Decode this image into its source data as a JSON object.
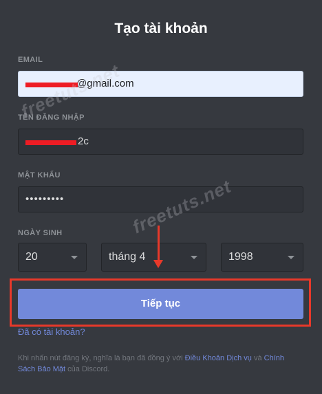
{
  "title": "Tạo tài khoản",
  "email": {
    "label": "EMAIL",
    "value": "@gmail.com"
  },
  "username": {
    "label": "TÊN ĐĂNG NHẬP",
    "value": "2c"
  },
  "password": {
    "label": "MẬT KHẨU",
    "value": "•••••••••"
  },
  "birthdate": {
    "label": "NGÀY SINH",
    "day": "20",
    "month": "tháng 4",
    "year": "1998"
  },
  "continue_button": "Tiếp tục",
  "login_link": "Đã có tài khoản?",
  "terms": {
    "prefix": "Khi nhấn nút đăng ký, nghĩa là bạn đã đồng ý với ",
    "tos_link": "Điều Khoản Dịch vụ",
    "middle": " và ",
    "privacy_link": "Chính Sách Bảo Mật",
    "suffix": " của Discord."
  },
  "watermark": "freetuts.net",
  "colors": {
    "background": "#36393f",
    "button": "#7289da",
    "annotation_red": "#e8392a",
    "link": "#7289da"
  }
}
